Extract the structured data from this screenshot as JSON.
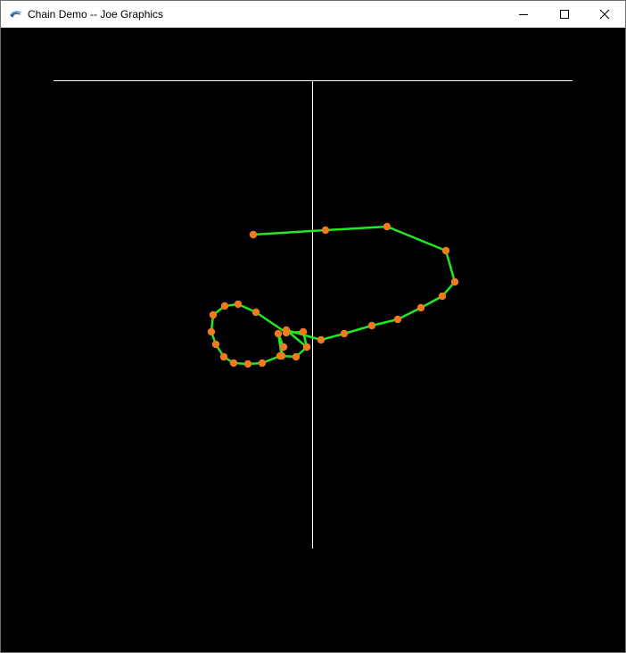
{
  "window": {
    "title": "Chain Demo -- Joe Graphics",
    "app_icon": "joe-graphics-app-icon",
    "controls": {
      "minimize_icon": "minimize-icon",
      "maximize_icon": "maximize-icon",
      "close_icon": "close-icon"
    }
  },
  "scene": {
    "background_color": "#000000",
    "axis_color": "#ffffff",
    "link_color": "#22e622",
    "joint_color": "#f07a1e"
  }
}
